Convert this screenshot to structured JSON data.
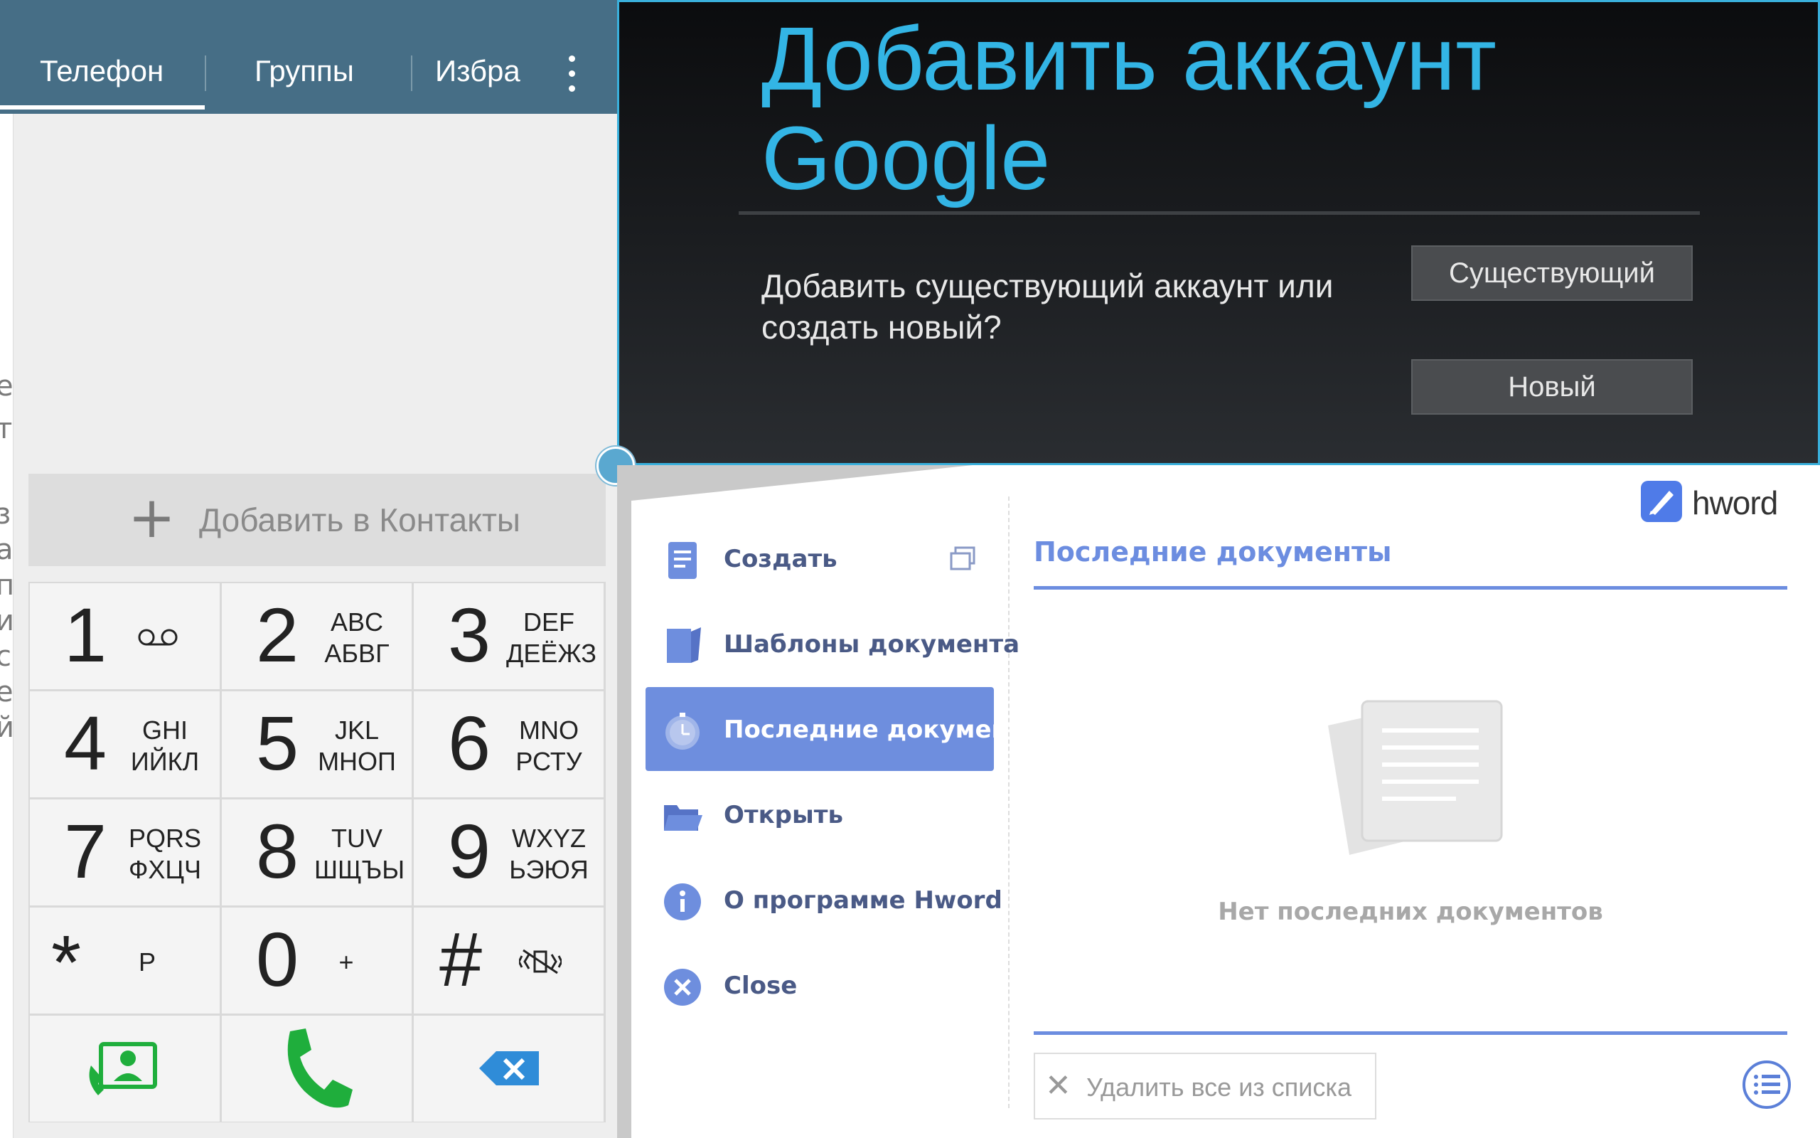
{
  "phone": {
    "tabs": [
      {
        "label": "Телефон",
        "active": true
      },
      {
        "label": "Группы"
      },
      {
        "label": "Избра"
      }
    ],
    "add_contacts_label": "Добавить в Контакты",
    "keys": [
      {
        "digit": "1",
        "sub1": "",
        "sub2": "",
        "icon": "voicemail-icon"
      },
      {
        "digit": "2",
        "sub1": "ABC",
        "sub2": "АБВГ"
      },
      {
        "digit": "3",
        "sub1": "DEF",
        "sub2": "ДЕЁЖЗ"
      },
      {
        "digit": "4",
        "sub1": "GHI",
        "sub2": "ИЙКЛ"
      },
      {
        "digit": "5",
        "sub1": "JKL",
        "sub2": "МНОП"
      },
      {
        "digit": "6",
        "sub1": "MNO",
        "sub2": "РСТУ"
      },
      {
        "digit": "7",
        "sub1": "PQRS",
        "sub2": "ФХЦЧ"
      },
      {
        "digit": "8",
        "sub1": "TUV",
        "sub2": "ШЩЪЫ"
      },
      {
        "digit": "9",
        "sub1": "WXYZ",
        "sub2": "ЬЭЮЯ"
      },
      {
        "digit": "*",
        "sub": "P"
      },
      {
        "digit": "0",
        "sub": "+"
      },
      {
        "digit": "#",
        "icon": "mute-vibrate-icon"
      }
    ],
    "colors": {
      "tab_bar": "#466e86",
      "call_green": "#1fae3c",
      "delete_blue": "#2f8cd8"
    }
  },
  "google_dialog": {
    "title": "Добавить аккаунт Google",
    "message": "Добавить существующий аккаунт или создать новый?",
    "existing_button": "Существующий",
    "new_button": "Новый",
    "colors": {
      "title": "#33b5e5",
      "border": "#3ab0dc"
    }
  },
  "hword": {
    "brand": "hword",
    "menu": [
      {
        "label": "Создать",
        "icon": "document-icon"
      },
      {
        "label": "Шаблоны документа",
        "icon": "template-icon"
      },
      {
        "label": "Последние документы",
        "icon": "clock-icon",
        "active": true
      },
      {
        "label": "Открыть",
        "icon": "folder-icon"
      },
      {
        "label": "О программе Hword",
        "icon": "info-icon"
      },
      {
        "label": "Close",
        "icon": "close-icon"
      }
    ],
    "recent_title": "Последние документы",
    "empty_text": "Нет последних документов",
    "clear_button": "Удалить все из списка",
    "colors": {
      "accent": "#6e8ede",
      "menu_text": "#4a5a86"
    }
  }
}
